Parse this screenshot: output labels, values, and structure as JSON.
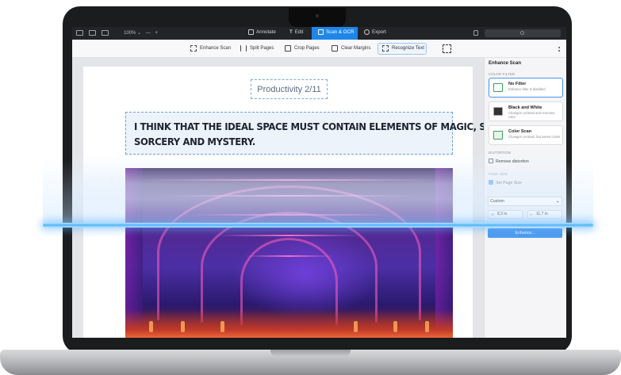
{
  "topbar": {
    "zoom": "100% ⌄",
    "zoom_minus": "—",
    "zoom_plus": "+",
    "tabs": [
      {
        "label": "Annotate"
      },
      {
        "label": "Edit"
      },
      {
        "label": "Scan & OCR"
      },
      {
        "label": "Export"
      }
    ],
    "active_tab": "Scan & OCR",
    "accent_color": "#1e86e8"
  },
  "toolbar": {
    "items": [
      {
        "label": "Enhance Scan"
      },
      {
        "label": "Split Pages"
      },
      {
        "label": "Crop Pages"
      },
      {
        "label": "Clear Margins"
      },
      {
        "label": "Recognize Text"
      }
    ]
  },
  "document": {
    "subtitle": "Productivity 2/11",
    "quote_line1": "I THINK THAT THE IDEAL SPACE MUST CONTAIN ELEMENTS OF MAGIC, SERENITY,",
    "quote_line2": "SORCERY AND MYSTERY."
  },
  "panel": {
    "title": "Enhance Scan",
    "color_filter_label": "COLOR FILTER",
    "filters": [
      {
        "title": "No Filter",
        "subtitle": "Enhance filter is disabled",
        "selected": true
      },
      {
        "title": "Black and White",
        "subtitle": "Changes contrast and removes color",
        "selected": false
      },
      {
        "title": "Color Scan",
        "subtitle": "Changes contrast, but saves colors",
        "selected": false
      }
    ],
    "distortion_label": "DISTORTION",
    "remove_distortion": "Remove distortion",
    "page_size_label": "PAGE SIZE",
    "set_page_size": "Set Page Size",
    "size_select": "Custom",
    "width_label": "W",
    "width_value": "8,3 in",
    "height_label": "H",
    "height_value": "11,7 in",
    "enhance_button": "Enhance..."
  }
}
